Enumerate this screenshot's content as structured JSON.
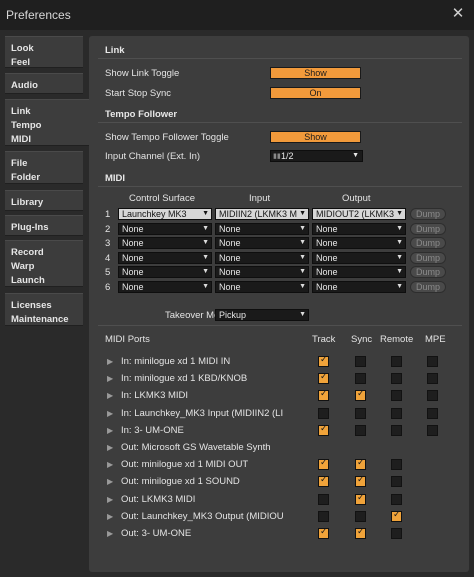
{
  "window": {
    "title": "Preferences",
    "close_glyph": "✕"
  },
  "sidebar": {
    "items": [
      {
        "label": "Look\nFeel"
      },
      {
        "label": "Audio"
      },
      {
        "label": "Link\nTempo\nMIDI"
      },
      {
        "label": "File\nFolder"
      },
      {
        "label": "Library"
      },
      {
        "label": "Plug-Ins"
      },
      {
        "label": "Record\nWarp\nLaunch"
      },
      {
        "label": "Licenses\nMaintenance"
      }
    ]
  },
  "link": {
    "section": "Link",
    "show_link_toggle_label": "Show Link Toggle",
    "show_link_toggle_value": "Show",
    "start_stop_sync_label": "Start Stop Sync",
    "start_stop_sync_value": "On"
  },
  "tempo": {
    "section": "Tempo Follower",
    "show_toggle_label": "Show Tempo Follower Toggle",
    "show_toggle_value": "Show",
    "input_channel_label": "Input Channel (Ext. In)",
    "input_channel_value": "1/2"
  },
  "midi": {
    "section": "MIDI",
    "col_control_surface": "Control Surface",
    "col_input": "Input",
    "col_output": "Output",
    "dump_label": "Dump",
    "rows": [
      {
        "num": "1",
        "surface": "Launchkey MK3",
        "input": "MIDIIN2 (LKMK3 M",
        "output": "MIDIOUT2 (LKMK3"
      },
      {
        "num": "2",
        "surface": "None",
        "input": "None",
        "output": "None"
      },
      {
        "num": "3",
        "surface": "None",
        "input": "None",
        "output": "None"
      },
      {
        "num": "4",
        "surface": "None",
        "input": "None",
        "output": "None"
      },
      {
        "num": "5",
        "surface": "None",
        "input": "None",
        "output": "None"
      },
      {
        "num": "6",
        "surface": "None",
        "input": "None",
        "output": "None"
      }
    ],
    "takeover_label": "Takeover Mode",
    "takeover_value": "Pickup"
  },
  "ports": {
    "header": "MIDI Ports",
    "col_track": "Track",
    "col_sync": "Sync",
    "col_remote": "Remote",
    "col_mpe": "MPE",
    "rows": [
      {
        "label": "In:   minilogue xd 1 MIDI IN",
        "track": true,
        "sync": false,
        "remote": false,
        "mpe": false
      },
      {
        "label": "In:   minilogue xd 1 KBD/KNOB",
        "track": true,
        "sync": false,
        "remote": false,
        "mpe": false
      },
      {
        "label": "In:   LKMK3 MIDI",
        "track": true,
        "sync": true,
        "remote": false,
        "mpe": false
      },
      {
        "label": "In:   Launchkey_MK3 Input (MIDIIN2 (LI",
        "track": false,
        "sync": false,
        "remote": false,
        "mpe": false
      },
      {
        "label": "In:   3- UM-ONE",
        "track": true,
        "sync": false,
        "remote": false,
        "mpe": false
      },
      {
        "label": "Out: Microsoft GS Wavetable Synth",
        "track": null,
        "sync": null,
        "remote": null,
        "mpe": null
      },
      {
        "label": "Out: minilogue xd 1 MIDI OUT",
        "track": true,
        "sync": true,
        "remote": false,
        "mpe": null
      },
      {
        "label": "Out: minilogue xd 1 SOUND",
        "track": true,
        "sync": true,
        "remote": false,
        "mpe": null
      },
      {
        "label": "Out: LKMK3 MIDI",
        "track": false,
        "sync": true,
        "remote": false,
        "mpe": null
      },
      {
        "label": "Out: Launchkey_MK3 Output (MIDIOU",
        "track": false,
        "sync": false,
        "remote": true,
        "mpe": null
      },
      {
        "label": "Out: 3- UM-ONE",
        "track": true,
        "sync": true,
        "remote": false,
        "mpe": null
      }
    ]
  },
  "colors": {
    "accent": "#f29a3b",
    "panel": "#3d3d3d",
    "background": "#2a2a2a"
  }
}
